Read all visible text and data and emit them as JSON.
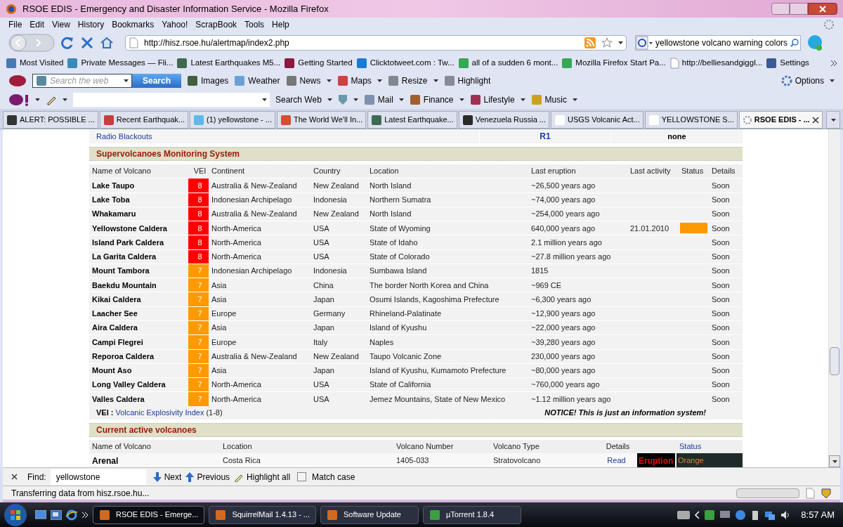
{
  "window": {
    "title": "RSOE EDIS - Emergency and Disaster Information Service - Mozilla Firefox"
  },
  "menu": [
    "File",
    "Edit",
    "View",
    "History",
    "Bookmarks",
    "Yahoo!",
    "ScrapBook",
    "Tools",
    "Help"
  ],
  "address_bar": {
    "url": "http://hisz.rsoe.hu/alertmap/index2.php"
  },
  "search_bar": {
    "value": "yellowstone volcano warning colors"
  },
  "bookmarks": [
    {
      "label": "Most Visited"
    },
    {
      "label": "Private Messages — Fli..."
    },
    {
      "label": "Latest Earthquakes M5..."
    },
    {
      "label": "Getting Started"
    },
    {
      "label": "Clicktotweet.com : Tw..."
    },
    {
      "label": "all of a sudden 6 mont..."
    },
    {
      "label": "Mozilla Firefox Start Pa..."
    },
    {
      "label": "http://belliesandgiggl..."
    },
    {
      "label": "Settings"
    }
  ],
  "ask_toolbar": {
    "placeholder": "Search the web",
    "button": "Search",
    "items": [
      "Images",
      "Weather",
      "News",
      "Maps",
      "Resize",
      "Highlight"
    ],
    "options": "Options"
  },
  "yahoo_toolbar": {
    "items": [
      "Search Web",
      "Mail",
      "Finance",
      "Lifestyle",
      "Music"
    ]
  },
  "tabs": [
    {
      "label": "ALERT: POSSIBLE ...",
      "selected": false
    },
    {
      "label": "Recent Earthquak...",
      "selected": false
    },
    {
      "label": "(1) yellowstone - ...",
      "selected": false
    },
    {
      "label": "The World We'll In...",
      "selected": false
    },
    {
      "label": "Latest Earthquake...",
      "selected": false
    },
    {
      "label": "Venezuela Russia ...",
      "selected": false
    },
    {
      "label": "USGS Volcanic Act...",
      "selected": false
    },
    {
      "label": "YELLOWSTONE S...",
      "selected": false
    },
    {
      "label": "RSOE EDIS - ...",
      "selected": true
    }
  ],
  "page": {
    "radio_row": {
      "label": "Radio Blackouts",
      "scale": "R1",
      "value": "none"
    },
    "supervolcanoes": {
      "title": "Supervolcanoes Monitoring System",
      "columns": [
        "Name of Volcano",
        "VEI",
        "Continent",
        "Country",
        "Location",
        "Last eruption",
        "Last activity",
        "Status",
        "Details"
      ],
      "rows": [
        {
          "name": "Lake Taupo",
          "vei": {
            "value": "8",
            "color": "#ff0000"
          },
          "continent": "Australia & New-Zealand",
          "country": "New Zealand",
          "location": "North Island",
          "last_eruption": "~26,500 years ago",
          "details": "Soon"
        },
        {
          "name": "Lake Toba",
          "vei": {
            "value": "8",
            "color": "#ff0000"
          },
          "continent": "Indonesian Archipelago",
          "country": "Indonesia",
          "location": "Northern Sumatra",
          "last_eruption": "~74,000 years ago",
          "details": "Soon"
        },
        {
          "name": "Whakamaru",
          "vei": {
            "value": "8",
            "color": "#ff0000"
          },
          "continent": "Australia & New-Zealand",
          "country": "New Zealand",
          "location": "North Island",
          "last_eruption": "~254,000 years ago",
          "details": "Soon"
        },
        {
          "name": "Yellowstone Caldera",
          "vei": {
            "value": "8",
            "color": "#ff0000"
          },
          "continent": "North-America",
          "country": "USA",
          "location": "State of Wyoming",
          "last_eruption": "640,000 years ago",
          "last_activity": "21.01.2010",
          "status": {
            "color": "#ff9900"
          },
          "details": "Soon"
        },
        {
          "name": "Island Park Caldera",
          "vei": {
            "value": "8",
            "color": "#ff0000"
          },
          "continent": "North-America",
          "country": "USA",
          "location": "State of Idaho",
          "last_eruption": "2.1 million years ago",
          "details": "Soon"
        },
        {
          "name": "La Garita Caldera",
          "vei": {
            "value": "8",
            "color": "#ff0000"
          },
          "continent": "North-America",
          "country": "USA",
          "location": "State of Colorado",
          "last_eruption": "~27.8 million years ago",
          "details": "Soon"
        },
        {
          "name": "Mount Tambora",
          "vei": {
            "value": "7",
            "color": "#ff9900"
          },
          "continent": "Indonesian Archipelago",
          "country": "Indonesia",
          "location": "Sumbawa Island",
          "last_eruption": "1815",
          "details": "Soon"
        },
        {
          "name": "Baekdu Mountain",
          "vei": {
            "value": "7",
            "color": "#ff9900"
          },
          "continent": "Asia",
          "country": "China",
          "location": "The border North Korea and China",
          "last_eruption": "~969 CE",
          "details": "Soon"
        },
        {
          "name": "Kikai Caldera",
          "vei": {
            "value": "7",
            "color": "#ff9900"
          },
          "continent": "Asia",
          "country": "Japan",
          "location": "Osumi Islands, Kagoshima Prefecture",
          "last_eruption": "~6,300 years ago",
          "details": "Soon"
        },
        {
          "name": "Laacher See",
          "vei": {
            "value": "7",
            "color": "#ff9900"
          },
          "continent": "Europe",
          "country": "Germany",
          "location": "Rhineland-Palatinate",
          "last_eruption": "~12,900 years ago",
          "details": "Soon"
        },
        {
          "name": "Aira Caldera",
          "vei": {
            "value": "7",
            "color": "#ff9900"
          },
          "continent": "Asia",
          "country": "Japan",
          "location": "Island of Kyushu",
          "last_eruption": "~22,000 years ago",
          "details": "Soon"
        },
        {
          "name": "Campi Flegrei",
          "vei": {
            "value": "7",
            "color": "#ff9900"
          },
          "continent": "Europe",
          "country": "Italy",
          "location": "Naples",
          "last_eruption": "~39,280 years ago",
          "details": "Soon"
        },
        {
          "name": "Reporoa Caldera",
          "vei": {
            "value": "7",
            "color": "#ff9900"
          },
          "continent": "Australia & New-Zealand",
          "country": "New Zealand",
          "location": "Taupo Volcanic Zone",
          "last_eruption": "230,000 years ago",
          "details": "Soon"
        },
        {
          "name": "Mount Aso",
          "vei": {
            "value": "7",
            "color": "#ff9900"
          },
          "continent": "Asia",
          "country": "Japan",
          "location": "Island of Kyushu, Kumamoto Prefecture",
          "last_eruption": "~80,000 years ago",
          "details": "Soon"
        },
        {
          "name": "Long Valley Caldera",
          "vei": {
            "value": "7",
            "color": "#ff9900"
          },
          "continent": "North-America",
          "country": "USA",
          "location": "State of California",
          "last_eruption": "~760,000 years ago",
          "details": "Soon"
        },
        {
          "name": "Valles Caldera",
          "vei": {
            "value": "7",
            "color": "#ff9900"
          },
          "continent": "North-America",
          "country": "USA",
          "location": "Jemez Mountains, State of New Mexico",
          "last_eruption": "~1.12 million years ago",
          "details": "Soon"
        }
      ],
      "footer": {
        "label": "VEI :",
        "link": "Volcanic Explosivity Index",
        "range": "(1-8)",
        "notice": "NOTICE! This is just an information system!"
      }
    },
    "active": {
      "title": "Current active volcanoes",
      "columns": [
        "Name of Volcano",
        "Location",
        "Volcano Number",
        "Volcano Type",
        "Details",
        "",
        "Status"
      ],
      "rows": [
        {
          "name": "Arenal",
          "location": "Costa Rica",
          "number": "1405-033",
          "type": "Stratovolcano",
          "details": "Read",
          "activity": "Eruption",
          "status": "Orange"
        }
      ]
    }
  },
  "find_bar": {
    "label": "Find:",
    "value": "yellowstone",
    "next": "Next",
    "previous": "Previous",
    "highlight": "Highlight all",
    "match_case": {
      "label": "Match case",
      "checked": false
    }
  },
  "status_bar": {
    "text": "Transferring data from hisz.rsoe.hu...",
    "progress": {
      "level": 0
    }
  },
  "taskbar": {
    "buttons": [
      {
        "label": "RSOE EDIS - Emerge...",
        "selected": true
      },
      {
        "label": "SquirrelMail 1.4.13 - ...",
        "selected": false
      },
      {
        "label": "Software Update",
        "selected": false
      },
      {
        "label": "µTorrent 1.8.4",
        "selected": false
      }
    ],
    "clock": "8:57 AM"
  }
}
